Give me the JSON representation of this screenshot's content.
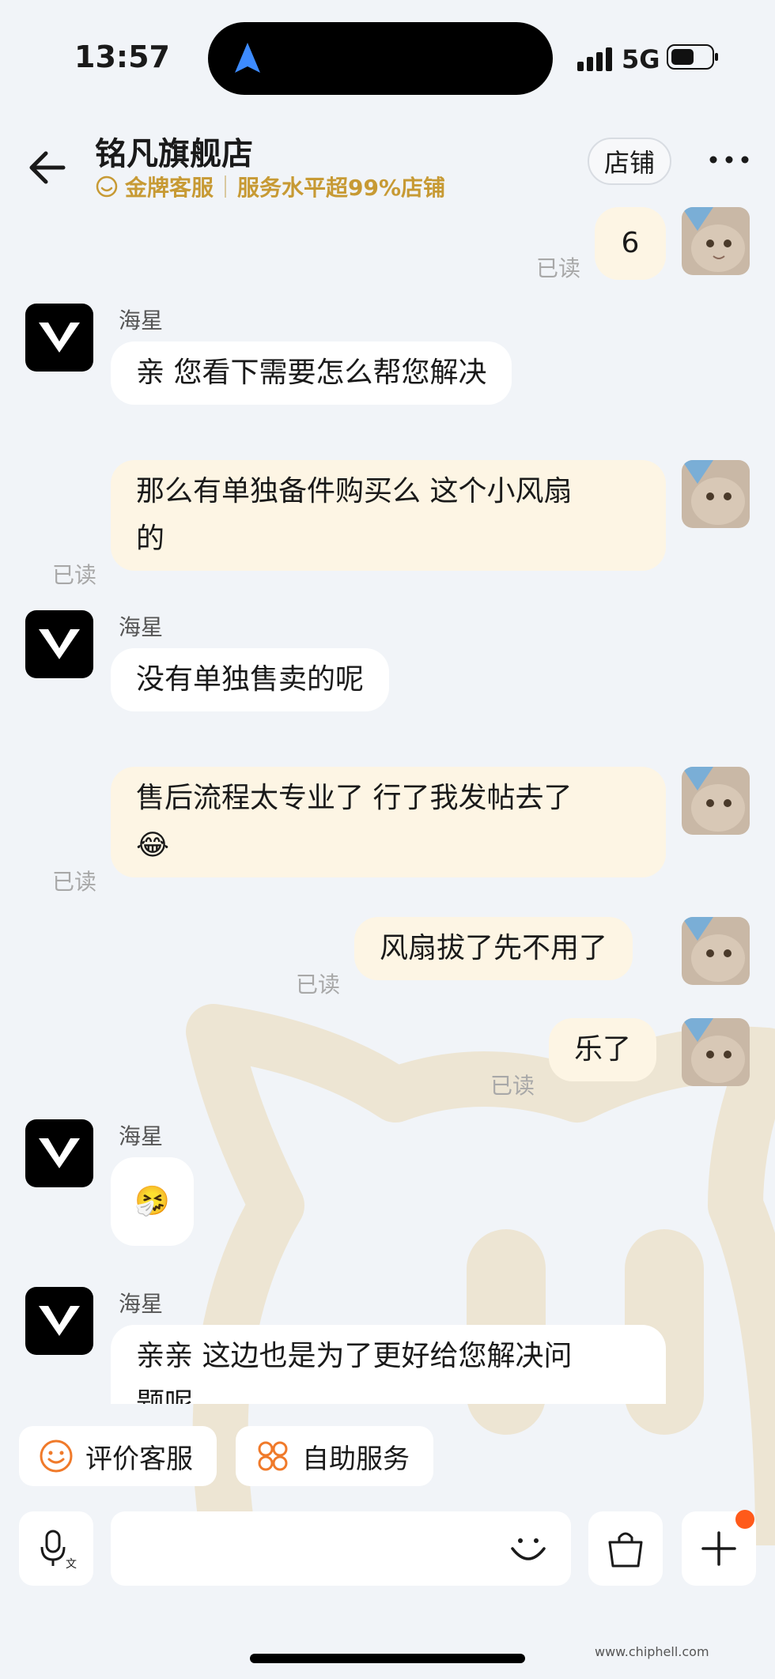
{
  "status": {
    "time": "13:57",
    "network": "5G"
  },
  "header": {
    "shop_name": "铭凡旗舰店",
    "badge_label": "金牌客服",
    "service_text": "服务水平超99%店铺",
    "store_button": "店铺"
  },
  "messages": [
    {
      "side": "out",
      "text": "6",
      "read": "已读"
    },
    {
      "side": "in",
      "sender": "海星",
      "text": "亲 您看下需要怎么帮您解决"
    },
    {
      "side": "out",
      "text_line1": "那么有单独备件购买么 这个小风扇",
      "text_line2": "的",
      "read": "已读"
    },
    {
      "side": "in",
      "sender": "海星",
      "text": "没有单独售卖的呢"
    },
    {
      "side": "out",
      "text_line1": "售后流程太专业了 行了我发帖去了",
      "text_line2": "😂",
      "read": "已读"
    },
    {
      "side": "out",
      "text": "风扇拔了先不用了",
      "read": "已读"
    },
    {
      "side": "out",
      "text": "乐了",
      "read": "已读"
    },
    {
      "side": "in",
      "sender": "海星",
      "text": "🤧"
    },
    {
      "side": "in",
      "sender": "海星",
      "text_line1": "亲亲 这边也是为了更好给您解决问",
      "text_line2": "题呢"
    }
  ],
  "quick_actions": [
    {
      "label": "评价客服",
      "icon": "smile-icon"
    },
    {
      "label": "自助服务",
      "icon": "grid-icon"
    }
  ],
  "watermark_site": "www.chiphell.com",
  "colors": {
    "accent_gold": "#c79a34",
    "bubble_out": "#fdf5e4",
    "badge": "#ff5a1a"
  }
}
